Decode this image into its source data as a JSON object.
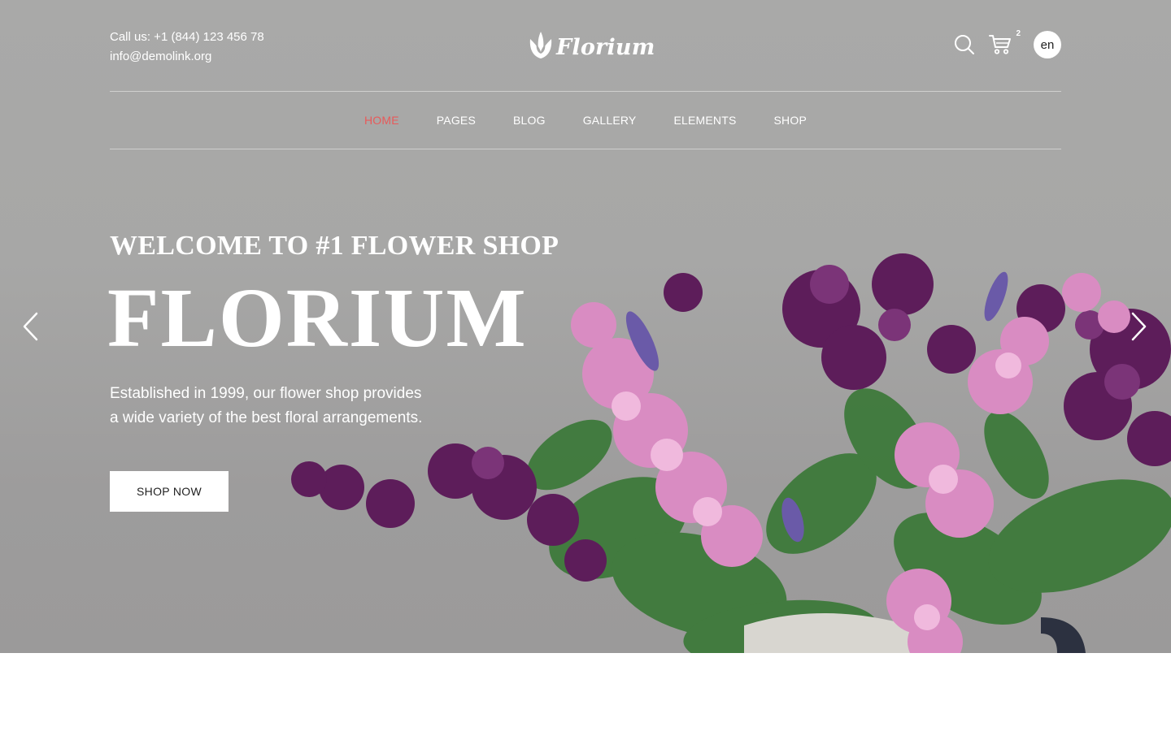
{
  "header": {
    "phone": "Call us: +1 (844) 123 456 78",
    "email": "info@demolink.org",
    "logo_text": "Florium",
    "cart_count": "2",
    "language": "en"
  },
  "nav": {
    "items": [
      {
        "label": "HOME",
        "active": true
      },
      {
        "label": "PAGES"
      },
      {
        "label": "BLOG"
      },
      {
        "label": "GALLERY"
      },
      {
        "label": "ELEMENTS"
      },
      {
        "label": "SHOP"
      }
    ]
  },
  "hero": {
    "welcome": "WELCOME TO #1 FLOWER SHOP",
    "title": "FLORIUM",
    "desc_line1": "Established in 1999, our flower shop provides",
    "desc_line2": "a wide variety of the best floral arrangements.",
    "cta": "SHOP NOW"
  },
  "colors": {
    "accent": "#e85a5a",
    "hero_bg": "#a8a8a7",
    "text_light": "#ffffff"
  },
  "icons": {
    "search": "search-icon",
    "cart": "cart-icon",
    "prev": "chevron-left-icon",
    "next": "chevron-right-icon",
    "logo": "tulip-icon"
  }
}
